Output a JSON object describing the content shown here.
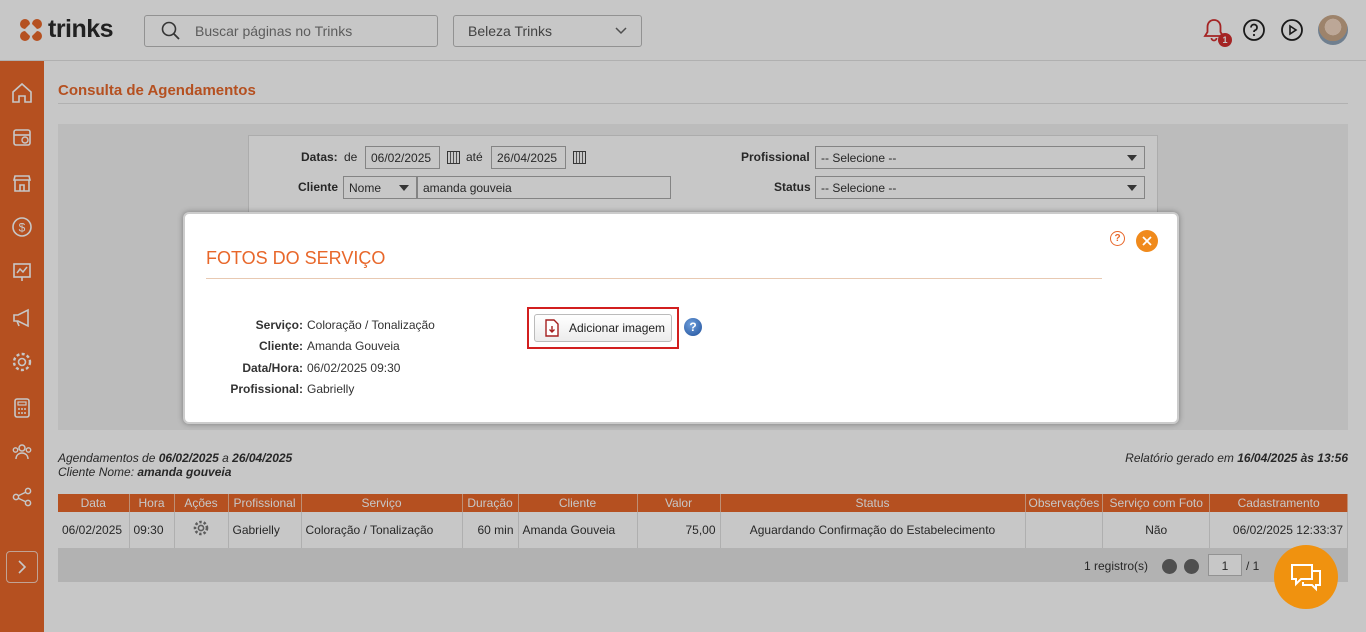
{
  "app": {
    "logo_text": "trinks",
    "brand_color": "#e8672a"
  },
  "header": {
    "search_placeholder": "Buscar páginas no Trinks",
    "company": "Beleza Trinks",
    "notification_count": "1",
    "icons": [
      "search-icon",
      "chevron-down-icon",
      "bell-icon",
      "help-icon",
      "play-icon",
      "avatar"
    ]
  },
  "sidebar": {
    "items": [
      "home-icon",
      "agenda-icon",
      "store-icon",
      "dollar-icon",
      "chart-icon",
      "megaphone-icon",
      "settings-icon",
      "calculator-icon",
      "team-icon",
      "share-icon"
    ]
  },
  "page": {
    "title": "Consulta de Agendamentos"
  },
  "filters": {
    "dates_label": "Datas:",
    "from_label": "de",
    "from_value": "06/02/2025",
    "to_label": "até",
    "to_value": "26/04/2025",
    "client_label": "Cliente",
    "client_type": "Nome",
    "client_value": "amanda gouveia",
    "professional_label": "Profissional",
    "professional_value": "-- Selecione --",
    "status_label": "Status",
    "status_value": "-- Selecione --"
  },
  "modal": {
    "title": "FOTOS DO SERVIÇO",
    "help": "?",
    "fields": [
      {
        "label": "Serviço:",
        "value": "Coloração / Tonalização"
      },
      {
        "label": "Cliente:",
        "value": "Amanda Gouveia"
      },
      {
        "label": "Data/Hora:",
        "value": "06/02/2025 09:30"
      },
      {
        "label": "Profissional:",
        "value": "Gabrielly"
      }
    ],
    "add_image_label": "Adicionar imagem",
    "info_help": "?"
  },
  "report": {
    "line1_prefix": "Agendamentos de ",
    "line1_from": "06/02/2025",
    "line1_mid": " a ",
    "line1_to": "26/04/2025",
    "line2_prefix": "Cliente Nome: ",
    "line2_value": "amanda gouveia",
    "generated_prefix": "Relatório gerado em ",
    "generated_value": "16/04/2025 às 13:56"
  },
  "table": {
    "headers": [
      "Data",
      "Hora",
      "Ações",
      "Profissional",
      "Serviço",
      "Duração",
      "Cliente",
      "Valor",
      "Status",
      "Observações",
      "Serviço com Foto",
      "Cadastramento"
    ],
    "row": {
      "data": "06/02/2025",
      "hora": "09:30",
      "profissional": "Gabrielly",
      "servico": "Coloração / Tonalização",
      "duracao": "60 min",
      "cliente": "Amanda Gouveia",
      "valor": "75,00",
      "status": "Aguardando Confirmação do Estabelecimento",
      "observacoes": "",
      "servico_com_foto": "Não",
      "cadastramento": "06/02/2025 12:33:37"
    }
  },
  "pager": {
    "count": "1 registro(s)",
    "page": "1",
    "total": "/ 1"
  }
}
